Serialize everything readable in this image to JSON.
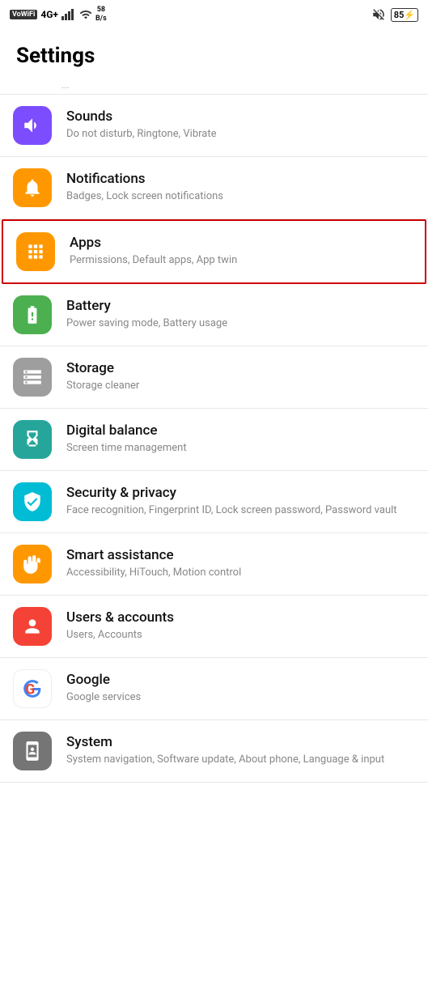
{
  "statusBar": {
    "left": {
      "wifiLabel": "VoWiFi",
      "signal": "4G+",
      "speedTop": "58",
      "speedBottom": "B/s"
    },
    "right": {
      "batteryLevel": "85",
      "charging": true
    }
  },
  "pageTitle": "Settings",
  "items": [
    {
      "id": "sounds",
      "title": "Sounds",
      "subtitle": "Do not disturb, Ringtone, Vibrate",
      "iconBg": "bg-purple",
      "iconType": "volume",
      "highlighted": false
    },
    {
      "id": "notifications",
      "title": "Notifications",
      "subtitle": "Badges, Lock screen notifications",
      "iconBg": "bg-orange",
      "iconType": "bell",
      "highlighted": false
    },
    {
      "id": "apps",
      "title": "Apps",
      "subtitle": "Permissions, Default apps, App twin",
      "iconBg": "bg-orange-apps",
      "iconType": "apps",
      "highlighted": true
    },
    {
      "id": "battery",
      "title": "Battery",
      "subtitle": "Power saving mode, Battery usage",
      "iconBg": "bg-green",
      "iconType": "battery",
      "highlighted": false
    },
    {
      "id": "storage",
      "title": "Storage",
      "subtitle": "Storage cleaner",
      "iconBg": "bg-gray",
      "iconType": "storage",
      "highlighted": false
    },
    {
      "id": "digital-balance",
      "title": "Digital balance",
      "subtitle": "Screen time management",
      "iconBg": "bg-teal",
      "iconType": "hourglass",
      "highlighted": false
    },
    {
      "id": "security",
      "title": "Security & privacy",
      "subtitle": "Face recognition, Fingerprint ID, Lock screen password, Password vault",
      "iconBg": "bg-teal2",
      "iconType": "shield",
      "highlighted": false
    },
    {
      "id": "smart-assistance",
      "title": "Smart assistance",
      "subtitle": "Accessibility, HiTouch, Motion control",
      "iconBg": "bg-orange-hand",
      "iconType": "hand",
      "highlighted": false
    },
    {
      "id": "users-accounts",
      "title": "Users & accounts",
      "subtitle": "Users, Accounts",
      "iconBg": "bg-red",
      "iconType": "person",
      "highlighted": false
    },
    {
      "id": "google",
      "title": "Google",
      "subtitle": "Google services",
      "iconBg": "bg-white-google",
      "iconType": "google",
      "highlighted": false
    },
    {
      "id": "system",
      "title": "System",
      "subtitle": "System navigation, Software update, About phone, Language & input",
      "iconBg": "bg-gray-system",
      "iconType": "phone-info",
      "highlighted": false
    }
  ]
}
